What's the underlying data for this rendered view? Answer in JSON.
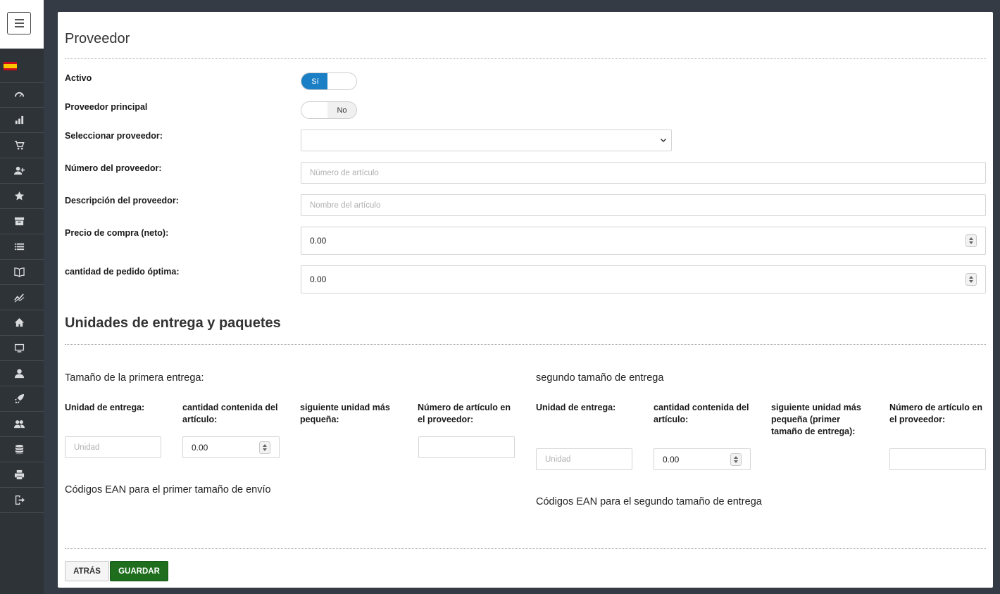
{
  "sidebar": {
    "menu_icon": "hamburger-icon",
    "language_flag": "spain-flag",
    "items": [
      {
        "icon": "dashboard-icon"
      },
      {
        "icon": "bar-chart-icon"
      },
      {
        "icon": "cart-icon"
      },
      {
        "icon": "add-user-icon"
      },
      {
        "icon": "star-icon"
      },
      {
        "icon": "archive-icon"
      },
      {
        "icon": "list-icon"
      },
      {
        "icon": "book-icon"
      },
      {
        "icon": "chart-line-icon"
      },
      {
        "icon": "home-icon"
      },
      {
        "icon": "monitor-icon"
      },
      {
        "icon": "user-icon"
      },
      {
        "icon": "rocket-icon"
      },
      {
        "icon": "users-icon"
      },
      {
        "icon": "database-icon"
      },
      {
        "icon": "print-icon"
      },
      {
        "icon": "logout-icon"
      }
    ]
  },
  "form": {
    "title": "Proveedor",
    "activo": {
      "label": "Activo",
      "on_label": "Sí",
      "value": true
    },
    "principal": {
      "label": "Proveedor principal",
      "off_label": "No",
      "value": false
    },
    "seleccionar": {
      "label": "Seleccionar proveedor:",
      "value": ""
    },
    "numero": {
      "label": "Número del proveedor:",
      "placeholder": "Número de artículo"
    },
    "descripcion": {
      "label": "Descripción del proveedor:",
      "placeholder": "Nombre del artículo"
    },
    "precio": {
      "label": "Precio de compra (neto):",
      "value": "0.00"
    },
    "cantidad": {
      "label": "cantidad de pedido óptima:",
      "value": "0.00"
    }
  },
  "delivery": {
    "title": "Unidades de entrega y paquetes",
    "first": {
      "title": "Tamaño de la primera entrega:",
      "unit_label": "Unidad de entrega:",
      "unit_placeholder": "Unidad",
      "qty_label": "cantidad contenida del artículo:",
      "qty_value": "0.00",
      "next_label": "siguiente unidad más pequeña:",
      "artnum_label": "Número de artículo en el proveedor:",
      "ean_title": "Códigos EAN para el primer tamaño de envío"
    },
    "second": {
      "title": "segundo tamaño de entrega",
      "unit_label": "Unidad de entrega:",
      "unit_placeholder": "Unidad",
      "qty_label": "cantidad contenida del artículo:",
      "qty_value": "0.00",
      "next_label": "siguiente unidad más pequeña (primer tamaño de entrega):",
      "artnum_label": "Número de artículo en el proveedor:",
      "ean_title": "Códigos EAN para el segundo tamaño de entrega"
    }
  },
  "buttons": {
    "back": "ATRÁS",
    "save": "GUARDAR"
  }
}
